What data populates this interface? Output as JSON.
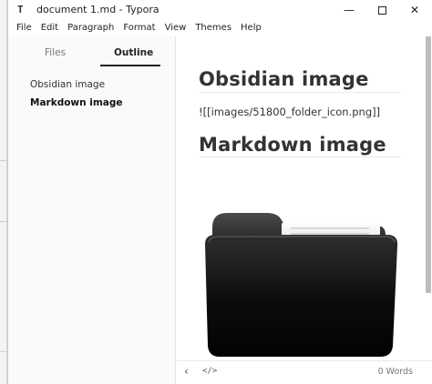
{
  "window": {
    "app_icon": "T",
    "title": "document 1.md - Typora",
    "minimize_glyph": "—",
    "close_glyph": "✕"
  },
  "menu": [
    "File",
    "Edit",
    "Paragraph",
    "Format",
    "View",
    "Themes",
    "Help"
  ],
  "sidebar": {
    "tabs": [
      {
        "label": "Files",
        "active": false
      },
      {
        "label": "Outline",
        "active": true
      }
    ],
    "outline": [
      {
        "label": "Obsidian image",
        "active": false
      },
      {
        "label": "Markdown image",
        "active": true
      }
    ]
  },
  "document": {
    "heading1": "Obsidian image",
    "paragraph": "![[images/51800_folder_icon.png]]",
    "heading2": "Markdown image",
    "image_icon": "folder-icon"
  },
  "status": {
    "back_glyph": "‹",
    "source_glyph": "</>",
    "word_count": "0 Words"
  },
  "colors": {
    "folder_dark": "#0a0a0a",
    "folder_mid": "#3a3a3a",
    "scroll_thumb": "#bdbdbd"
  }
}
